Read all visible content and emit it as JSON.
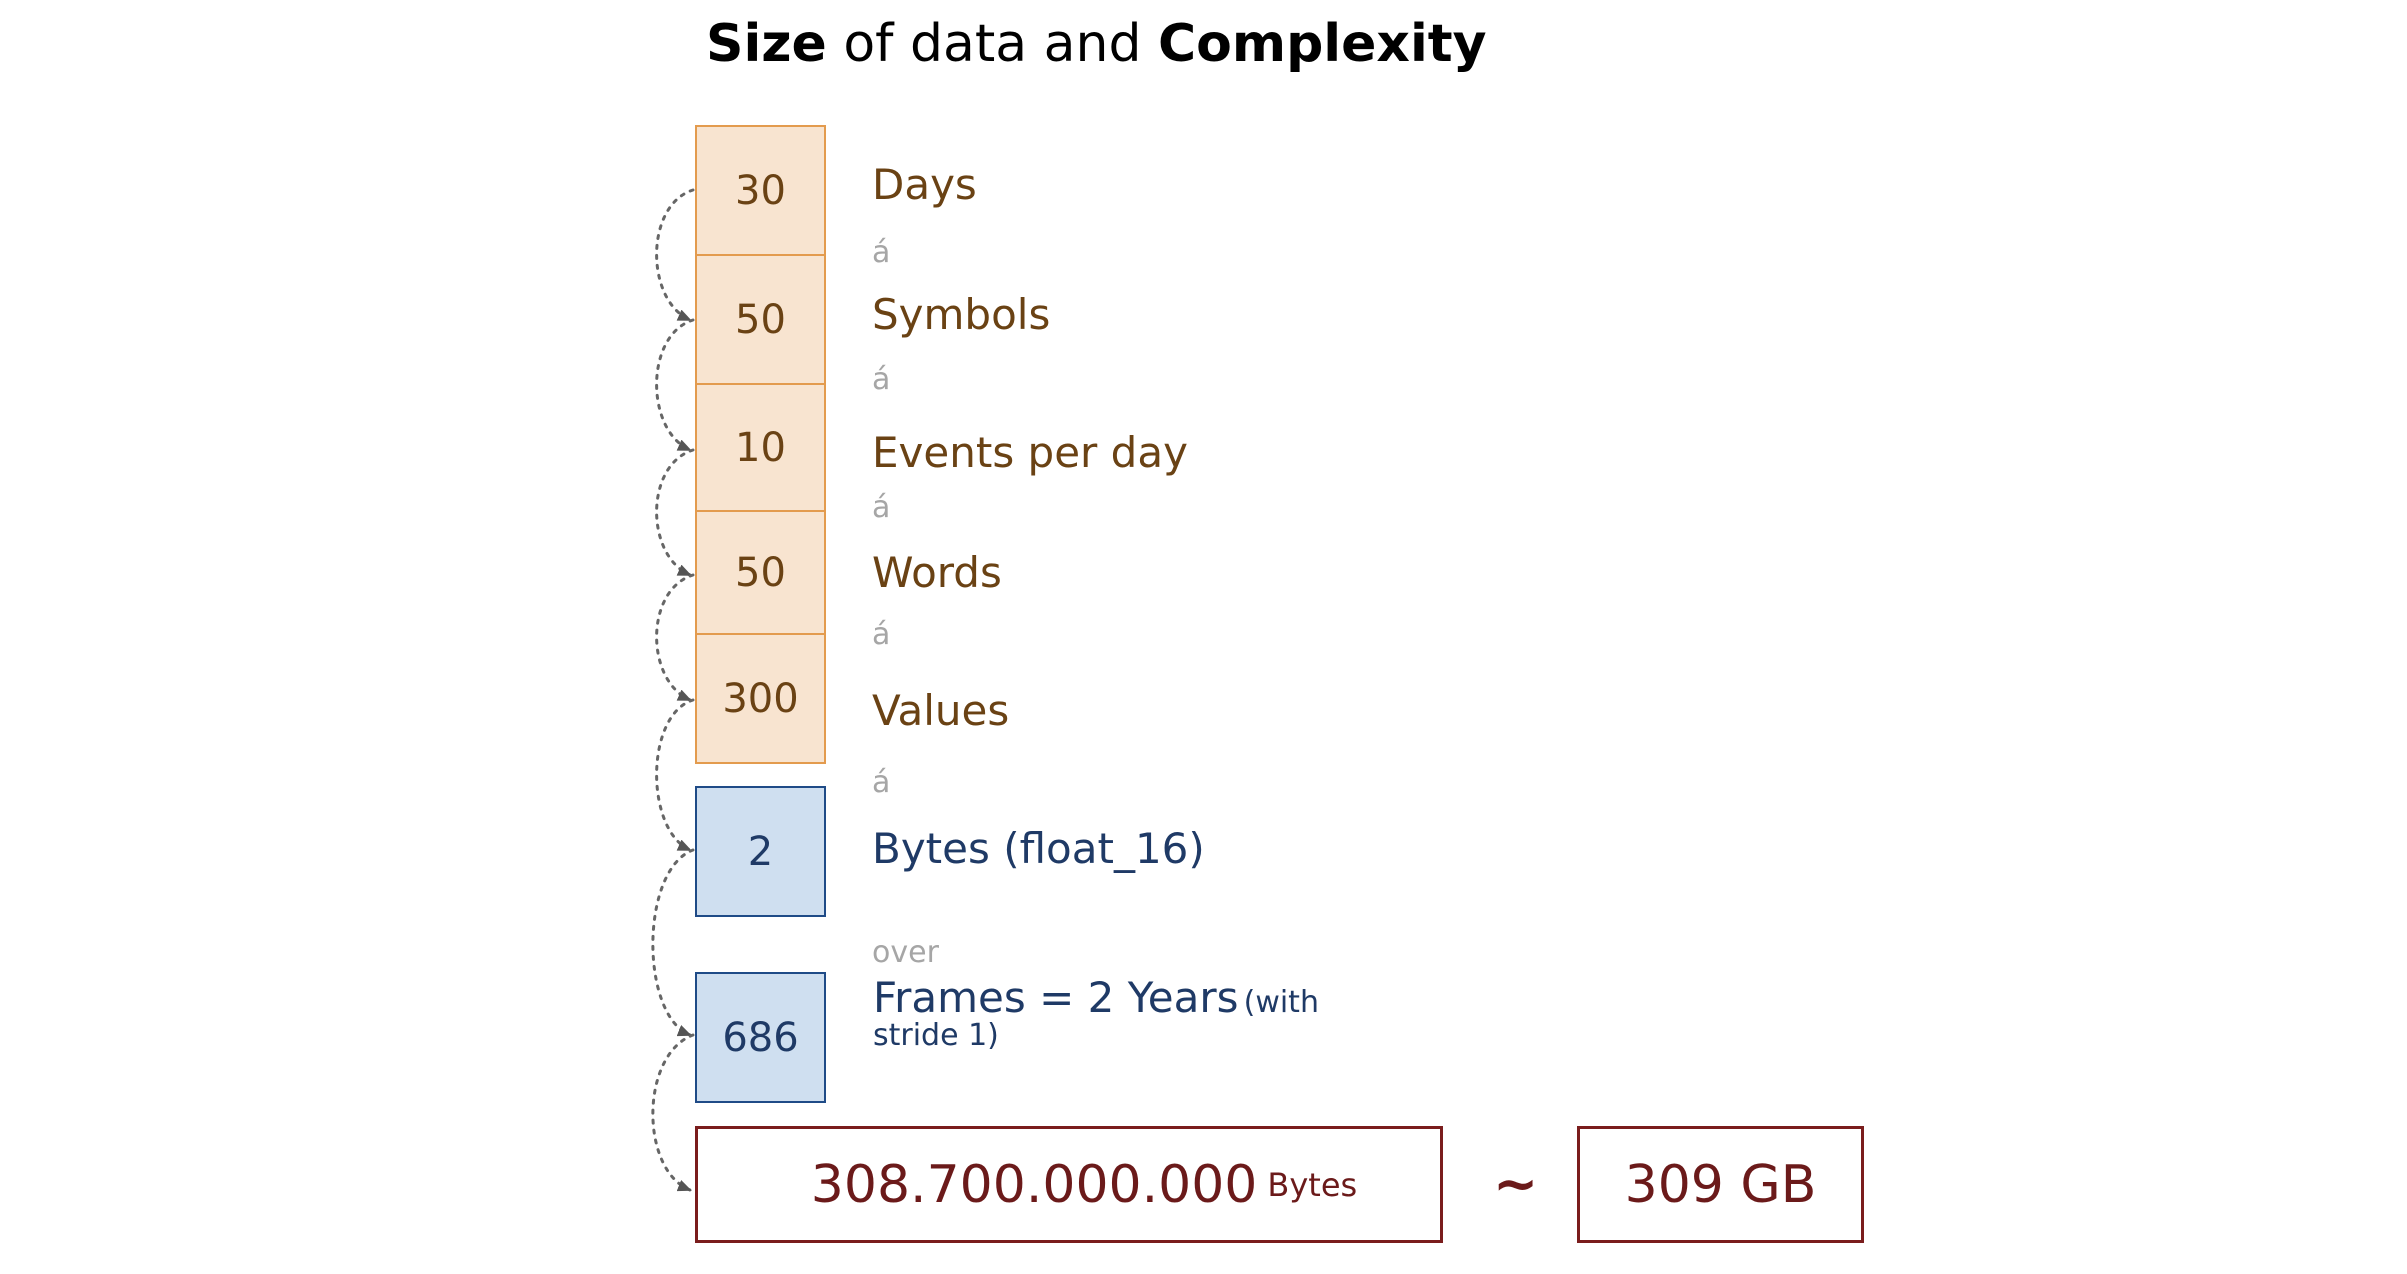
{
  "title": {
    "bold1": "Size",
    "middle": " of data and ",
    "bold2": "Complexity"
  },
  "rows": [
    {
      "value": "30",
      "label": "Days",
      "color": "orange"
    },
    {
      "value": "50",
      "label": "Symbols",
      "color": "orange"
    },
    {
      "value": "10",
      "label": "Events per day",
      "color": "orange"
    },
    {
      "value": "50",
      "label": "Words",
      "color": "orange"
    },
    {
      "value": "300",
      "label": "Values",
      "color": "orange"
    },
    {
      "value": "2",
      "label": "Bytes (float_16)",
      "color": "blue"
    },
    {
      "value": "686",
      "label": "Frames = 2 Years",
      "label_small": "(with stride 1)",
      "color": "blue"
    }
  ],
  "separators": {
    "multiply": "á",
    "over": "over"
  },
  "frames_label": {
    "main": "Frames = 2 Years",
    "paren_start": "(with",
    "paren_end": "stride 1)"
  },
  "result": {
    "total_value": "308.700.000.000",
    "total_unit": "Bytes",
    "approx_symbol": "~",
    "rounded": "309 GB"
  },
  "colors": {
    "orange_fill": "#f8e4d0",
    "orange_border": "#e39b4e",
    "blue_fill": "#cfdff0",
    "blue_border": "#1f4b87",
    "result_border": "#7a1d1d"
  }
}
